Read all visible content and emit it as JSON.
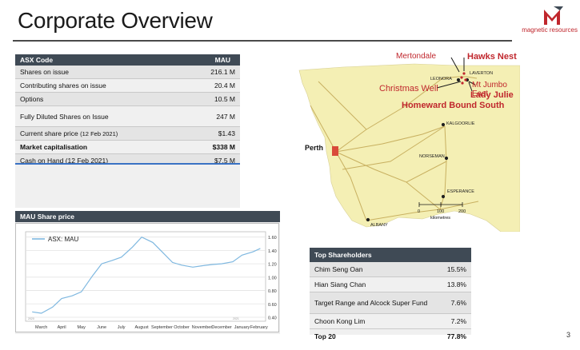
{
  "slide": {
    "title": "Corporate Overview",
    "page_number": "3"
  },
  "logo": {
    "text": "magnetic resources"
  },
  "asx_table": {
    "header": {
      "label": "ASX Code",
      "value": "MAU"
    },
    "rows": [
      {
        "label": "Shares on issue",
        "value": "216.1 M"
      },
      {
        "label": "Contributing shares on issue",
        "value": "20.4 M"
      },
      {
        "label": "Options",
        "value": "10.5 M"
      },
      {
        "label": "Fully Diluted Shares on Issue",
        "value": "247 M"
      },
      {
        "label": "Current share price",
        "label_note": "(12 Feb 2021)",
        "value": "$1.43"
      },
      {
        "label": "Market capitalisation",
        "value": "$338 M"
      },
      {
        "label": "Cash on Hand (12 Feb 2021)",
        "value": "$7.5 M"
      }
    ]
  },
  "share_price": {
    "header": "MAU Share price",
    "chart_data": {
      "type": "line",
      "series": [
        {
          "name": "ASX: MAU",
          "x": [
            "2020-03-01",
            "2020-03-15",
            "2020-04-01",
            "2020-04-15",
            "2020-05-01",
            "2020-05-15",
            "2020-06-01",
            "2020-06-15",
            "2020-07-01",
            "2020-07-15",
            "2020-08-01",
            "2020-08-15",
            "2020-09-01",
            "2020-09-15",
            "2020-10-01",
            "2020-10-15",
            "2020-11-01",
            "2020-11-15",
            "2020-12-01",
            "2020-12-15",
            "2021-01-01",
            "2021-01-15",
            "2021-02-01",
            "2021-02-12"
          ],
          "values": [
            0.48,
            0.46,
            0.55,
            0.68,
            0.72,
            0.78,
            1.02,
            1.2,
            1.25,
            1.3,
            1.45,
            1.6,
            1.52,
            1.38,
            1.22,
            1.18,
            1.15,
            1.17,
            1.19,
            1.2,
            1.23,
            1.33,
            1.38,
            1.43
          ]
        }
      ],
      "x_tick_labels": [
        "March",
        "April",
        "May",
        "June",
        "July",
        "August",
        "September",
        "October",
        "November",
        "December",
        "January",
        "February"
      ],
      "y_ticks": [
        0.4,
        0.6,
        0.8,
        1.0,
        1.2,
        1.4,
        1.6
      ],
      "y_tick_labels": [
        "0.40",
        "0.60",
        "0.80",
        "1.00",
        "1.20",
        "1.40",
        "1.60"
      ],
      "year_labels": [
        "2020",
        "2021"
      ],
      "ylim": [
        0.34,
        1.68
      ],
      "grid": true,
      "legend": "top-left",
      "line_color": "#7fb8e0"
    }
  },
  "map": {
    "labels": {
      "mertondale": "Mertondale",
      "hawks_nest": "Hawks Nest",
      "christmas_well": "Christmas Well",
      "mt_jumbo_east": "Mt Jumbo East",
      "lady_julie": "Lady Julie",
      "homeward_bound_south": "Homeward Bound South",
      "leonora": "LEONORA",
      "laverton": "LAVERTON",
      "kalgoorlie": "KALGOORLIE",
      "perth": "Perth",
      "norseman": "NORSEMAN",
      "esperance": "ESPERANCE",
      "albany": "ALBANY"
    },
    "scale": {
      "ticks": [
        "0",
        "100",
        "200"
      ],
      "unit": "kilometres"
    },
    "label_color": "#c0272d",
    "land_color": "#f4efb4"
  },
  "shareholders": {
    "header": "Top Shareholders",
    "rows": [
      {
        "name": "Chim Seng Oan",
        "pct": "15.5%"
      },
      {
        "name": "Hian Siang Chan",
        "pct": "13.8%"
      },
      {
        "name": "Target Range and Alcock Super Fund",
        "pct": "7.6%"
      },
      {
        "name": "Choon Kong Lim",
        "pct": "7.2%"
      },
      {
        "name": "Top 20",
        "pct": "77.8%"
      }
    ]
  }
}
